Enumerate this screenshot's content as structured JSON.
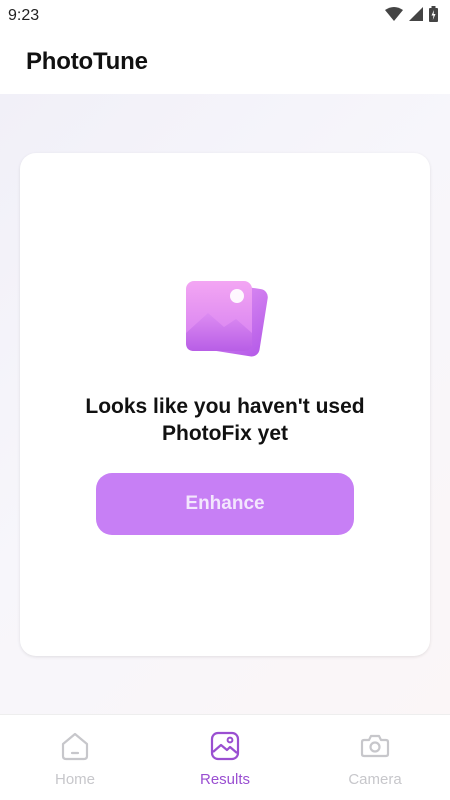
{
  "status_bar": {
    "time": "9:23",
    "icons": [
      "wifi-icon",
      "signal-icon",
      "battery-icon"
    ]
  },
  "header": {
    "title": "PhotoTune"
  },
  "empty_state": {
    "illustration": "photo-stack-icon",
    "message": "Looks like you haven't used PhotoFix yet",
    "button_label": "Enhance"
  },
  "bottom_nav": {
    "items": [
      {
        "label": "Home",
        "icon": "home-icon",
        "active": false
      },
      {
        "label": "Results",
        "icon": "image-icon",
        "active": true
      },
      {
        "label": "Camera",
        "icon": "camera-icon",
        "active": false
      }
    ]
  },
  "colors": {
    "accent": "#c77ff5",
    "active_nav": "#9a4fd1",
    "inactive_nav": "#c7c7cb"
  }
}
